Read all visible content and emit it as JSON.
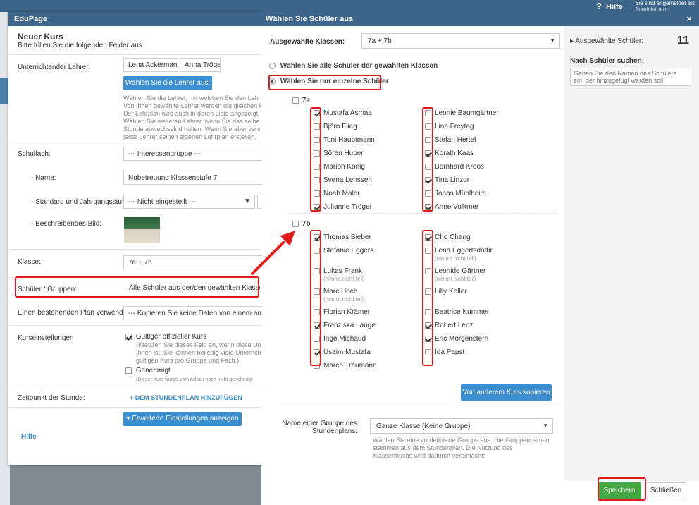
{
  "topbar": {
    "help": "Hilfe",
    "login_line1": "Sie sind angemeldet als",
    "login_line2": "Administrator"
  },
  "left": {
    "app_title": "EduPage",
    "title": "Neuer Kurs",
    "subtitle": "Bitte füllen Sie die folgenden Felder aus",
    "teacher_label": "Unterrichtender Lehrer:",
    "teachers": [
      "Lena Ackermann",
      "Anna Tröger"
    ],
    "choose_teacher_btn": "Wählen Sie die Lehrer aus:",
    "teacher_help": [
      "Wählen Sie die Lehrer, mit welchen Sie den Lehr",
      "Von Ihnen gewählte Lehrer werden die gleichen F",
      "Der Lehrplan wird auch in deren Liste angezeigt.",
      "Wählen Sie weiteren Lehrer, wenn Sie das selbe",
      "Stunde abwechselnd halten. Wenn Sie aber verse",
      "jeder Lehrer seinen eigenen Lehrplan erstellen."
    ],
    "subject_label": "Schulfach:",
    "subject_value": "--- Interessengruppe ---",
    "name_label": "- Name:",
    "name_value": "Nobetreuung Klassenstufe 7",
    "standard_label": "- Standard und Jahrgangsstufe:",
    "standard_value": "--- Nicht eingestellt ---",
    "image_label": "- Beschreibendes Bild:",
    "class_label": "Klasse:",
    "class_value": "7a + 7b",
    "students_label": "Schüler / Gruppen:",
    "students_value": "Alle Schüler aus der/den gewählten Klasse/n",
    "plan_label": "Einen bestehenden Plan verwenden:",
    "plan_value": "--- Kopieren Sie keine Daten von einem anderen",
    "settings_label": "Kurseinstellungen",
    "official_label": "Gültiger offizieller Kurs",
    "official_help": [
      "(Kreuzen Sie dieses Feld an, wenn diese Un",
      "Ihnen ist. Sie können beliebig viele Unterrich",
      "gültigen Kurs pro Gruppe und Fach.)"
    ],
    "approved_label": "Genehmigt",
    "approved_help": "(Dieser Kurs wurde vom Admin noch nicht genehmigt",
    "time_label": "Zeitpunkt der Stunde:",
    "add_timetable": "+ DEM STUNDENPLAN HINZUFÜGEN",
    "advanced_btn": "Erweiterte Einstellungen anzeigen",
    "help_link": "Hilfe"
  },
  "dialog": {
    "title": "Wählen Sie Schüler aus",
    "close": "×",
    "classes_label": "Ausgewählte Klassen:",
    "classes_value": "7a + 7b",
    "radio_all": "Wählen Sie alle Schüler der gewählten Klassen",
    "radio_individual": "Wählen Sie nur einzelne Schüler",
    "class_7a": "7a",
    "class_7b": "7b",
    "students_7a_left": [
      {
        "name": "Mustafa Asmaa",
        "checked": true
      },
      {
        "name": "Björn Flieg",
        "checked": false
      },
      {
        "name": "Toni Hauptmann",
        "checked": false
      },
      {
        "name": "Sören Huber",
        "checked": false
      },
      {
        "name": "Marion König",
        "checked": false
      },
      {
        "name": "Svena Lenssen",
        "checked": false
      },
      {
        "name": "Noah Maler",
        "checked": false
      },
      {
        "name": "Julianne Tröger",
        "checked": true
      }
    ],
    "students_7a_right": [
      {
        "name": "Leonie Baumgärtner",
        "checked": false
      },
      {
        "name": "Lina Freytag",
        "checked": false
      },
      {
        "name": "Stefan Hertel",
        "checked": false
      },
      {
        "name": "Korath Kaas",
        "checked": true
      },
      {
        "name": "Bernhard Kroos",
        "checked": false
      },
      {
        "name": "Tina Linzor",
        "checked": true
      },
      {
        "name": "Jonas Mühlheim",
        "checked": false
      },
      {
        "name": "Anne Volkmer",
        "checked": true
      }
    ],
    "students_7b_left": [
      {
        "name": "Thomas Bieber",
        "checked": true,
        "note": ""
      },
      {
        "name": "Stefanie Eggers",
        "checked": false,
        "note": ""
      },
      {
        "name": "Lukas Frank",
        "checked": false,
        "note": "(nimmt nicht teil)"
      },
      {
        "name": "Marc Hoch",
        "checked": false,
        "note": "(nimmt nicht teil)"
      },
      {
        "name": "Florian Krämer",
        "checked": false,
        "note": ""
      },
      {
        "name": "Franziska Lange",
        "checked": true,
        "note": ""
      },
      {
        "name": "Inge Michaud",
        "checked": false,
        "note": ""
      },
      {
        "name": "Usaim Mustafa",
        "checked": true,
        "note": ""
      },
      {
        "name": "Marco Traumann",
        "checked": false,
        "note": ""
      }
    ],
    "students_7b_right": [
      {
        "name": "Cho Chang",
        "checked": true,
        "note": ""
      },
      {
        "name": "Lena Eggertsdóttir",
        "checked": false,
        "note": "(nimmt nicht teil)"
      },
      {
        "name": "Leonide Gärtner",
        "checked": false,
        "note": "(nimmt nicht teil)"
      },
      {
        "name": "Lilly Keller",
        "checked": false,
        "note": ""
      },
      {
        "name": "Beatrice Kummer",
        "checked": false,
        "note": ""
      },
      {
        "name": "Robert Lenz",
        "checked": true,
        "note": ""
      },
      {
        "name": "Eric Morgenstern",
        "checked": true,
        "note": ""
      },
      {
        "name": "Ida Papst",
        "checked": false,
        "note": ""
      }
    ],
    "copy_btn": "Von anderem Kurs kopieren",
    "group_label_1": "Name einer Gruppe des",
    "group_label_2": "Stundenplans:",
    "group_value": "Ganze Klasse (Keine Gruppe)",
    "group_help": [
      "Wählen Sie eine vordefinierte Gruppe aus. Die Gruppennamen",
      "stammen aus dem Stundenplan. Die Nutzung des",
      "Klassenbuchs wird dadurch vereinfacht!"
    ],
    "selected_label": "Ausgewählte Schüler:",
    "selected_count": "11",
    "search_label": "Nach Schüler suchen:",
    "search_placeholder": "Geben Sie den Namen des Schülers ein, der hinzugefügt werden soll",
    "save_btn": "Speichern",
    "close_btn": "Schließen"
  },
  "colors": {
    "header": "#3d6589",
    "accent": "#3b8ed0",
    "save": "#43a843",
    "highlight": "#e01b1b"
  }
}
